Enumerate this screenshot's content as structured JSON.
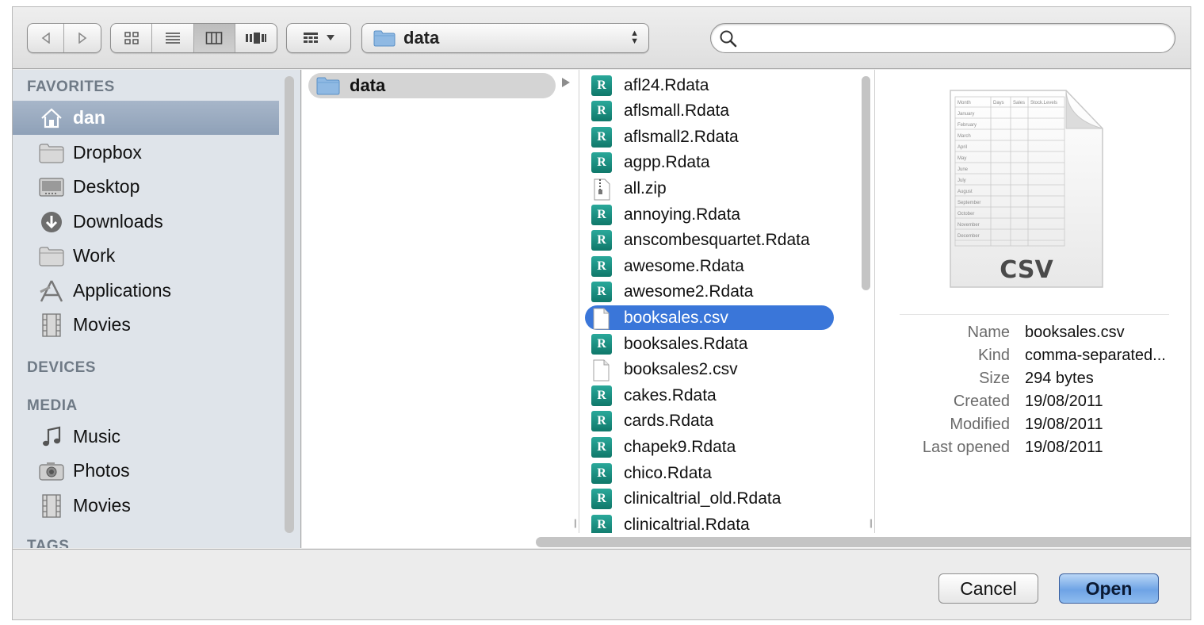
{
  "toolbar": {
    "nav": [
      "back-icon",
      "forward-icon"
    ],
    "views": [
      "icon-view-icon",
      "list-view-icon",
      "column-view-icon",
      "cover-flow-icon"
    ],
    "active_view": "column-view-icon",
    "arrange": "arrange-icon",
    "location": "data",
    "search": {
      "value": "",
      "placeholder": ""
    }
  },
  "sidebar": {
    "favorites_header": "FAVORITES",
    "favorites": [
      {
        "label": "dan",
        "icon": "home-icon",
        "selected": true
      },
      {
        "label": "Dropbox",
        "icon": "folder-icon"
      },
      {
        "label": "Desktop",
        "icon": "desktop-icon"
      },
      {
        "label": "Downloads",
        "icon": "downloads-icon"
      },
      {
        "label": "Work",
        "icon": "folder-icon"
      },
      {
        "label": "Applications",
        "icon": "applications-icon"
      },
      {
        "label": "Movies",
        "icon": "movies-icon"
      }
    ],
    "devices_header": "DEVICES",
    "media_header": "MEDIA",
    "media": [
      {
        "label": "Music",
        "icon": "music-icon"
      },
      {
        "label": "Photos",
        "icon": "camera-icon"
      },
      {
        "label": "Movies",
        "icon": "movies-icon"
      }
    ],
    "tags_header": "TAGS"
  },
  "column1": {
    "folder": "data"
  },
  "column2": {
    "files": [
      {
        "name": "afl24.Rdata",
        "type": "r"
      },
      {
        "name": "aflsmall.Rdata",
        "type": "r"
      },
      {
        "name": "aflsmall2.Rdata",
        "type": "r"
      },
      {
        "name": "agpp.Rdata",
        "type": "r"
      },
      {
        "name": "all.zip",
        "type": "zip"
      },
      {
        "name": "annoying.Rdata",
        "type": "r"
      },
      {
        "name": "anscombesquartet.Rdata",
        "type": "r"
      },
      {
        "name": "awesome.Rdata",
        "type": "r"
      },
      {
        "name": "awesome2.Rdata",
        "type": "r"
      },
      {
        "name": "booksales.csv",
        "type": "doc",
        "selected": true
      },
      {
        "name": "booksales.Rdata",
        "type": "r"
      },
      {
        "name": "booksales2.csv",
        "type": "doc"
      },
      {
        "name": "cakes.Rdata",
        "type": "r"
      },
      {
        "name": "cards.Rdata",
        "type": "r"
      },
      {
        "name": "chapek9.Rdata",
        "type": "r"
      },
      {
        "name": "chico.Rdata",
        "type": "r"
      },
      {
        "name": "clinicaltrial_old.Rdata",
        "type": "r"
      },
      {
        "name": "clinicaltrial.Rdata",
        "type": "r"
      }
    ]
  },
  "preview": {
    "icon_label": "CSV",
    "info": [
      {
        "key": "Name",
        "value": "booksales.csv"
      },
      {
        "key": "Kind",
        "value": "comma-separated..."
      },
      {
        "key": "Size",
        "value": "294 bytes"
      },
      {
        "key": "Created",
        "value": "19/08/2011"
      },
      {
        "key": "Modified",
        "value": "19/08/2011"
      },
      {
        "key": "Last opened",
        "value": "19/08/2011"
      }
    ]
  },
  "buttons": {
    "cancel": "Cancel",
    "open": "Open"
  }
}
